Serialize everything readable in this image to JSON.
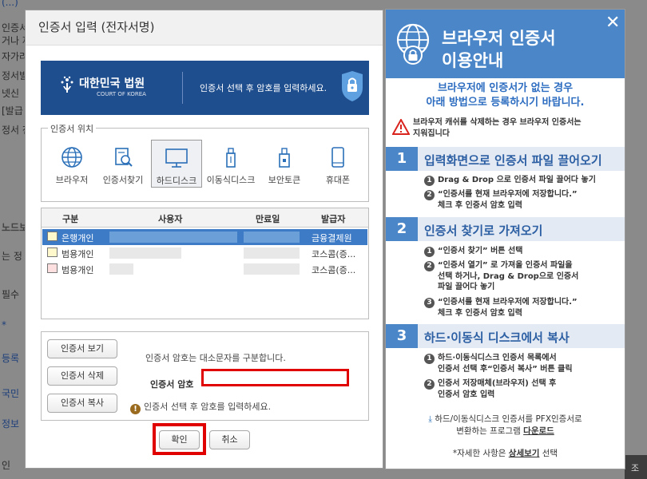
{
  "background": {
    "fragments": [
      "(...)",
      "인증서",
      "거나 제",
      "자가려",
      "정서발",
      "넷신",
      "[발급",
      "정서 전",
      "노드보",
      "는 정",
      "필수",
      "*",
      "등록",
      "국민",
      "정보",
      "인"
    ],
    "bottom_right": "조"
  },
  "dialog": {
    "title": "인증서 입력 (전자서명)",
    "banner": {
      "court_name": "대한민국 법원",
      "court_sub": "COURT OF KOREA",
      "message": "인증서 선택 후 암호를 입력하세요."
    },
    "location": {
      "legend": "인증서 위치",
      "items": [
        {
          "label": "브라우저",
          "icon": "globe-icon"
        },
        {
          "label": "인증서찾기",
          "icon": "search-doc-icon"
        },
        {
          "label": "하드디스크",
          "icon": "monitor-icon"
        },
        {
          "label": "이동식디스크",
          "icon": "usb-icon"
        },
        {
          "label": "보안토큰",
          "icon": "token-icon"
        },
        {
          "label": "휴대폰",
          "icon": "phone-icon"
        }
      ],
      "selected_index": 2
    },
    "table": {
      "headers": [
        "구분",
        "사용자",
        "만료일",
        "발급자"
      ],
      "rows": [
        {
          "type": "은행개인",
          "issuer": "금융결제원",
          "selected": true
        },
        {
          "type": "범용개인",
          "issuer": "코스콤(증...",
          "selected": false
        },
        {
          "type": "범용개인",
          "issuer": "코스콤(증...",
          "selected": false
        }
      ]
    },
    "actions": {
      "view_label": "인증서 보기",
      "delete_label": "인증서 삭제",
      "copy_label": "인증서 복사",
      "case_notice": "인증서 암호는 대소문자를 구분합니다.",
      "password_label": "인증서 암호",
      "password_value": "",
      "warn_text": "인증서 선택 후 암호를 입력하세요.",
      "warn_icon": "exclamation-icon"
    },
    "ok_label": "확인",
    "cancel_label": "취소"
  },
  "guide": {
    "title_line1": "브라우저 인증서",
    "title_line2": "이용안내",
    "close_glyph": "✕",
    "intro_line1": "브라우저에 인증서가 없는 경우",
    "intro_line2": "아래 방법으로 등록하시기 바랍니다.",
    "cache_warn_line1": "브라우저 캐쉬를 삭제하는 경우 브라우저 인증서는",
    "cache_warn_line2": "지워집니다",
    "steps": [
      {
        "num": "1",
        "title": "입력화면으로 인증서 파일 끌어오기",
        "items": [
          {
            "n": "1",
            "lines": [
              "Drag & Drop 으로 인증서 파일 끌어다 놓기"
            ]
          },
          {
            "n": "2",
            "lines": [
              "“인증서를 현재 브라우저에 저장합니다.”",
              "체크 후 인증서 암호 입력"
            ]
          }
        ]
      },
      {
        "num": "2",
        "title": "인증서 찾기로 가져오기",
        "items": [
          {
            "n": "1",
            "lines": [
              "“인증서 찾기” 버튼 선택"
            ]
          },
          {
            "n": "2",
            "lines": [
              "“인증서 열기” 로 가져올 인증서 파일을",
              "선택 하거나, Drag & Drop으로 인증서",
              "파일 끌어다 놓기"
            ]
          },
          {
            "n": "3",
            "lines": [
              "“인증서를 현재 브라우저에 저장합니다.”",
              "체크 후 인증서 암호 입력"
            ]
          }
        ]
      },
      {
        "num": "3",
        "title": "하드·이동식 디스크에서 복사",
        "items": [
          {
            "n": "1",
            "lines": [
              "하드·이동식디스크 인증서 목록에서",
              "인증서 선택 후“인증서 복사” 버튼 클릭"
            ]
          },
          {
            "n": "2",
            "lines": [
              "인증서 저장매체(브라우저) 선택 후",
              "인증서 암호 입력"
            ]
          }
        ]
      }
    ],
    "pfx_line1": "하드/이동식디스크 인증서를 PFX인증서로",
    "pfx_line2_pre": "변환하는 프로그램 ",
    "pfx_link": "다운로드",
    "detail_pre": "*자세한 사항은 ",
    "detail_link": "상세보기",
    "detail_post": " 선택"
  },
  "colors": {
    "banner_blue": "#1f4e8e",
    "guide_blue": "#4a86c8",
    "highlight_red": "#e00000",
    "selected_row": "#3d7bc7"
  }
}
